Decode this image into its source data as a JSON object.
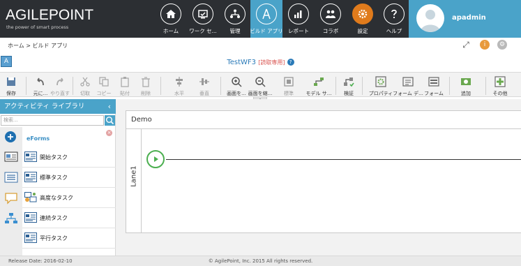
{
  "brand": {
    "name": "AGILEPOINT",
    "tagline": "the power of smart process"
  },
  "nav": [
    {
      "label": "ホーム",
      "icon": "home-icon"
    },
    {
      "label": "ワーク セ...",
      "icon": "work-center-icon"
    },
    {
      "label": "管理",
      "icon": "manage-icon"
    },
    {
      "label": "ビルド アプリ",
      "icon": "build-apps-icon"
    },
    {
      "label": "レポート",
      "icon": "reports-icon"
    },
    {
      "label": "コラボ",
      "icon": "collaboration-icon"
    },
    {
      "label": "設定",
      "icon": "settings-icon"
    },
    {
      "label": "ヘルプ",
      "icon": "help-icon"
    }
  ],
  "user": {
    "name": "apadmin"
  },
  "breadcrumb": "ホーム > ビルド アプリ",
  "title": {
    "name": "TestWF3",
    "readonly": "[読取専用]",
    "help": "?"
  },
  "toolbar": [
    {
      "label": "保存",
      "icon": "save-icon"
    },
    {
      "label": "元に...",
      "icon": "undo-icon"
    },
    {
      "label": "やり直す",
      "icon": "redo-icon"
    },
    {
      "label": "切取",
      "icon": "cut-icon"
    },
    {
      "label": "コピー",
      "icon": "copy-icon"
    },
    {
      "label": "貼付",
      "icon": "paste-icon"
    },
    {
      "label": "削除",
      "icon": "delete-icon"
    },
    {
      "label": "水平",
      "icon": "align-horizontal-icon"
    },
    {
      "label": "垂直",
      "icon": "align-vertical-icon"
    },
    {
      "label": "画面を...",
      "icon": "zoom-in-icon"
    },
    {
      "label": "画面を縮...",
      "icon": "zoom-out-icon"
    },
    {
      "label": "標準",
      "icon": "standard-size-icon"
    },
    {
      "label": "モデル サ...",
      "icon": "model-icon"
    },
    {
      "label": "検証",
      "icon": "validate-icon"
    },
    {
      "label": "プロパティ",
      "icon": "properties-icon"
    },
    {
      "label": "フォーム デ...",
      "icon": "form-design-icon"
    },
    {
      "label": "フォーム",
      "icon": "form-icon"
    },
    {
      "label": "追加",
      "icon": "add-icon"
    },
    {
      "label": "その他",
      "icon": "more-icon"
    }
  ],
  "sidebar": {
    "title": "アクティビティ ライブラリ",
    "search_placeholder": "検索...",
    "category": "eForms",
    "items": [
      {
        "label": "開始タスク"
      },
      {
        "label": "標準タスク"
      },
      {
        "label": "高度なタスク"
      },
      {
        "label": "連続タスク"
      },
      {
        "label": "平行タスク"
      }
    ]
  },
  "canvas": {
    "pool": "Demo",
    "lane": "Lane1"
  },
  "footer": {
    "release": "Release Date: 2016-02-10",
    "copyright": "© AgilePoint, Inc. 2015 All rights reserved."
  },
  "colors": {
    "topbar": "#2c2f33",
    "accent": "#4aa3c9",
    "start": "#4caf50"
  }
}
